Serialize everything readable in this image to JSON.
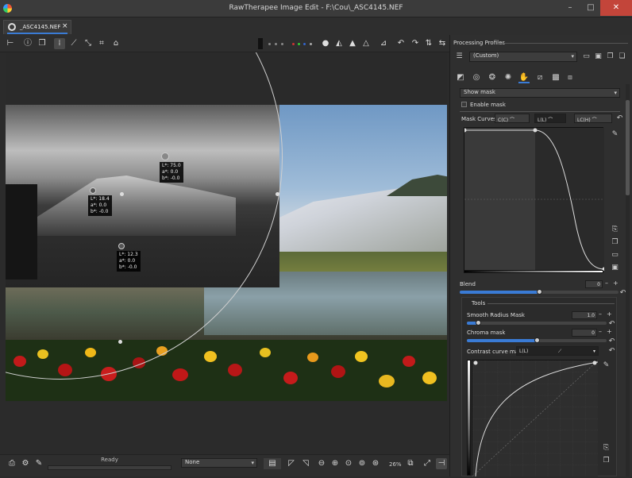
{
  "window": {
    "title": "RawTherapee Image Edit - F:\\Cou\\_ASC4145.NEF",
    "minimize": "–",
    "maximize": "□",
    "close": "✕"
  },
  "tab": {
    "label": "_ASC4145.NEF",
    "close": "×"
  },
  "toolbar": {
    "icons": [
      "hide-panel-icon",
      "info-icon",
      "copy-icon",
      "crop-select-icon",
      "color-picker-icon",
      "straighten-icon",
      "crop-icon",
      "transform-icon",
      "preview-indicator-icon",
      "focus-mask-icon",
      "warning-icon",
      "clipping-icon",
      "histogram-icon",
      "rotate-left-icon",
      "rotate-right-icon",
      "flip-vertical-icon",
      "flip-horizontal-icon"
    ]
  },
  "viewer": {
    "pickers": [
      {
        "l": "L*: 75.0",
        "a": "a*: 0.0",
        "b": "b*: -0.0"
      },
      {
        "l": "L*: 18.4",
        "a": "a*: 0.0",
        "b": "b*: -0.0"
      },
      {
        "l": "L*: 12.3",
        "a": "a*: 0.0",
        "b": "b*: -0.0"
      }
    ]
  },
  "status": {
    "ready": "Ready",
    "profile_select": "None",
    "zoom": "26%"
  },
  "right_panel": {
    "processing_profiles_label": "Processing Profiles",
    "profile_value": "(Custom)",
    "show_mask_select": "Show mask",
    "enable_mask_label": "Enable mask",
    "mask_curves_label": "Mask Curves",
    "curve_buttons": [
      "C(C)",
      "L(L)",
      "LC(H)"
    ],
    "blend_label": "Blend",
    "blend_value": "0",
    "tools_label": "Tools",
    "smooth_radius_label": "Smooth Radius Mask",
    "smooth_radius_value": "1.0",
    "chroma_mask_label": "Chroma mask",
    "chroma_mask_value": "0",
    "contrast_curve_label": "Contrast curve mask",
    "contrast_curve_select": "L(L)",
    "plus": "+",
    "minus": "–",
    "sliders": {
      "blend_fraction": 0.5,
      "smooth_radius_fraction": 0.08,
      "chroma_fraction": 0.5
    }
  },
  "colors": {
    "accent": "#3a7bd5",
    "close_red": "#c3453a"
  }
}
